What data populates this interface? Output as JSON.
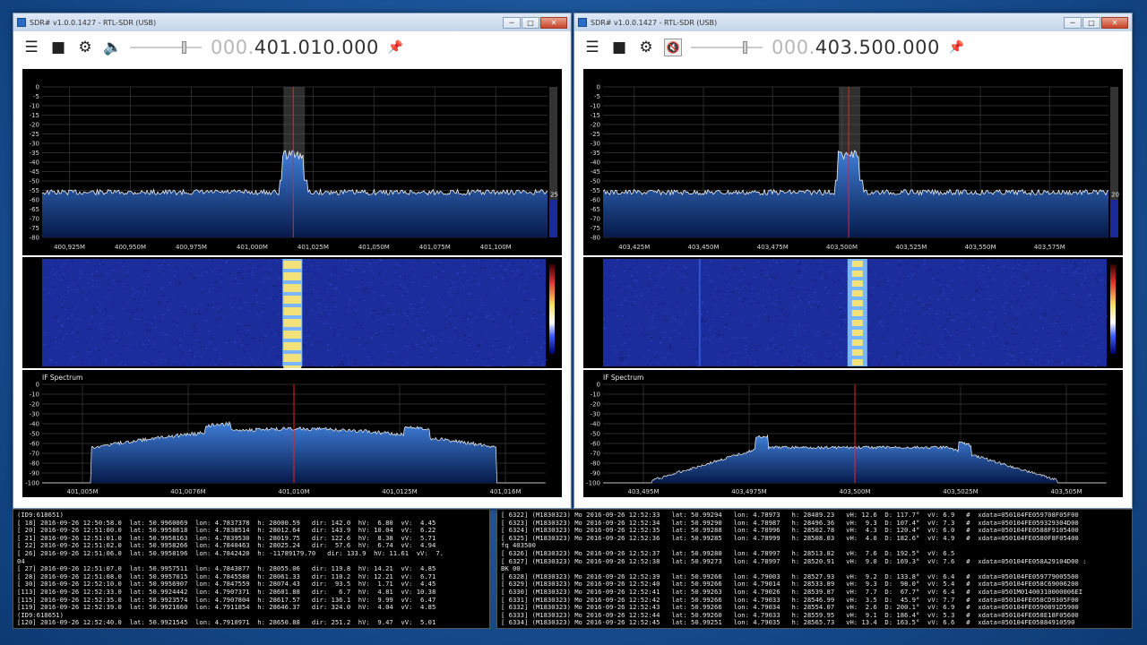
{
  "windows": [
    {
      "title": "SDR# v1.0.0.1427 - RTL-SDR (USB)",
      "freq_dim": "000.",
      "freq_main": "401.010.000",
      "volume_icon": "speaker-icon",
      "spectrum": {
        "y_ticks": [
          "0",
          "-5",
          "-10",
          "-15",
          "-20",
          "-25",
          "-30",
          "-35",
          "-40",
          "-45",
          "-50",
          "-55",
          "-60",
          "-65",
          "-70",
          "-75",
          "-80"
        ],
        "x_ticks": [
          "400,925M",
          "400,950M",
          "400,975M",
          "401,000M",
          "401,025M",
          "401,050M",
          "401,075M",
          "401,100M"
        ],
        "gain_value": "25"
      },
      "if_spectrum": {
        "title": "IF Spectrum",
        "y_ticks": [
          "0",
          "-10",
          "-20",
          "-30",
          "-40",
          "-50",
          "-60",
          "-70",
          "-80",
          "-90",
          "-100"
        ],
        "x_ticks": [
          "401,005M",
          "401,0076M",
          "401,010M",
          "401,0125M",
          "401,016M"
        ]
      }
    },
    {
      "title": "SDR# v1.0.0.1427 - RTL-SDR (USB)",
      "freq_dim": "000.",
      "freq_main": "403.500.000",
      "volume_icon": "mute-icon",
      "spectrum": {
        "y_ticks": [
          "0",
          "-5",
          "-10",
          "-15",
          "-20",
          "-25",
          "-30",
          "-35",
          "-40",
          "-45",
          "-50",
          "-55",
          "-60",
          "-65",
          "-70",
          "-75",
          "-80"
        ],
        "x_ticks": [
          "403,425M",
          "403,450M",
          "403,475M",
          "403,500M",
          "403,525M",
          "403,550M",
          "403,575M"
        ],
        "gain_value": "20"
      },
      "if_spectrum": {
        "title": "IF Spectrum",
        "y_ticks": [
          "0",
          "-10",
          "-20",
          "-30",
          "-40",
          "-50",
          "-60",
          "-70",
          "-80",
          "-90",
          "-100"
        ],
        "x_ticks": [
          "403,495M",
          "403,4975M",
          "403,500M",
          "403,5025M",
          "403,505M"
        ]
      }
    }
  ],
  "log_left": [
    "(ID9:618651)",
    "[ 18] 2016-09-26 12:50:58.0  lat: 50.9960069  lon: 4.7837378  h: 28000.59   dir: 142.0  hV:  6.80  vV:  4.45",
    "[ 20] 2016-09-26 12:51:00.0  lat: 50.9958618  lon: 4.7838514  h: 28012.64   dir: 143.9  hV: 10.04  vV:  6.22",
    "[ 21] 2016-09-26 12:51:01.0  lat: 50.9958163  lon: 4.7839530  h: 28019.75   dir: 122.6  hV:  8.38  vV:  5.71",
    "[ 22] 2016-09-26 12:51:02.0  lat: 50.9958266  lon: 4.7840463  h: 28025.24   dir:  57.6  hV:  6.74  vV:  4.94",
    "[ 26] 2016-09-26 12:51:06.0  lat: 50.9958196  lon: 4.7842420  h: -11789179.70   dir: 133.9  hV: 11.61  vV:  7.",
    "04",
    "[ 27] 2016-09-26 12:51:07.0  lat: 50.9957511  lon: 4.7843877  h: 28055.06   dir: 119.8  hV: 14.21  vV:  4.85",
    "[ 28] 2016-09-26 12:51:08.0  lat: 50.9957015  lon: 4.7845580  h: 28061.33   dir: 110.2  hV: 12.21  vV:  6.71",
    "[ 30] 2016-09-26 12:52:10.0  lat: 50.9956907  lon: 4.7847559  h: 28074.43   dir:  93.5  hV:  1.71  vV:  4.45",
    "[113] 2016-09-26 12:52:33.0  lat: 50.9924442  lon: 4.7907371  h: 28601.88   dir:   6.7  hV:  4.81  vV: 10.38",
    "[115] 2016-09-26 12:52:35.0  lat: 50.9923574  lon: 4.7907804  h: 28617.57   dir: 136.1  hV:  9.99  vV:  6.47",
    "[119] 2016-09-26 12:52:39.0  lat: 50.9921660  lon: 4.7911854  h: 28646.37   dir: 324.0  hV:  4.04  vV:  4.85",
    "(ID9:618651)",
    "[120] 2016-09-26 12:52:40.0  lat: 50.9921545  lon: 4.7910971  h: 28650.88   dir: 251.2  hV:  9.47  vV:  5.01"
  ],
  "log_right": [
    "[ 6322] (M1830323) Mo 2016-09-26 12:52:33   lat: 50.99294   lon: 4.78973   h: 28489.23   vH: 12.6  D: 117.7°  vV: 6.9   #  xdata=050104FE059708F05F00",
    "[ 6323] (M1830323) Mo 2016-09-26 12:52:34   lat: 50.99290   lon: 4.78987   h: 28496.36   vH:  9.3  D: 107.4°  vV: 7.3   #  xdata=050104FE059329304D00",
    "[ 6324] (M1830323) Mo 2016-09-26 12:52:35   lat: 50.99288   lon: 4.78996   h: 28502.78   vH:  4.3  D: 120.4°  vV: 6.0   #  xdata=050104FE0588F9105400",
    "[ 6325] (M1830323) Mo 2016-09-26 12:52:36   lat: 50.99285   lon: 4.78999   h: 28508.03   vH:  4.0  D: 182.6°  vV: 4.9   #  xdata=050104FE0580F8F05400",
    "fq 403500",
    "[ 6326] (M1830323) Mo 2016-09-26 12:52:37   lat: 50.99280   lon: 4.78997   h: 28513.82   vH:  7.6  D: 192.5°  vV: 6.5",
    "[ 6327] (M1830323) Mo 2016-09-26 12:52:38   lat: 50.99273   lon: 4.78997   h: 28520.91   vH:  9.0  D: 169.3°  vV: 7.6   #  xdata=050104FE058A29104D00 :",
    "BK 00",
    "[ 6328] (M1830323) Mo 2016-09-26 12:52:39   lat: 50.99266   lon: 4.79003   h: 28527.93   vH:  9.2  D: 133.8°  vV: 6.4   #  xdata=050104FE059779005500",
    "[ 6329] (M1830323) Mo 2016-09-26 12:52:40   lat: 50.99266   lon: 4.79014   h: 28533.89   vH:  9.3  D:  98.0°  vV: 5.4   #  xdata=050104FE058C69006200",
    "[ 6330] (M1830323) Mo 2016-09-26 12:52:41   lat: 50.99263   lon: 4.79026   h: 28539.87   vH:  7.7  D:  67.7°  vV: 6.4   #  xdata=0501M01400310000006EI",
    "[ 6331] (M1830323) Mo 2016-09-26 12:52:42   lat: 50.99266   lon: 4.79033   h: 28546.99   vH:  3.5  D:  45.9°  vV: 7.7   #  xdata=050104FE058CD9305F00",
    "[ 6332] (M1830323) Mo 2016-09-26 12:52:43   lat: 50.99266   lon: 4.79034   h: 28554.07   vH:  2.6  D: 200.1°  vV: 6.9   #  xdata=050104FE0590891D5900",
    "[ 6333] (M1830323) Mo 2016-09-26 12:52:44   lat: 50.99260   lon: 4.79033   h: 28559.95   vH:  9.1  D: 186.4°  vV: 5.3   #  xdata=050104FE058E18F05600",
    "[ 6334] (M1830323) Mo 2016-09-26 12:52:45   lat: 50.99251   lon: 4.79035   h: 28565.73   vH: 13.4  D: 163.5°  vV: 6.6   #  xdata=050104FE05884910590"
  ]
}
